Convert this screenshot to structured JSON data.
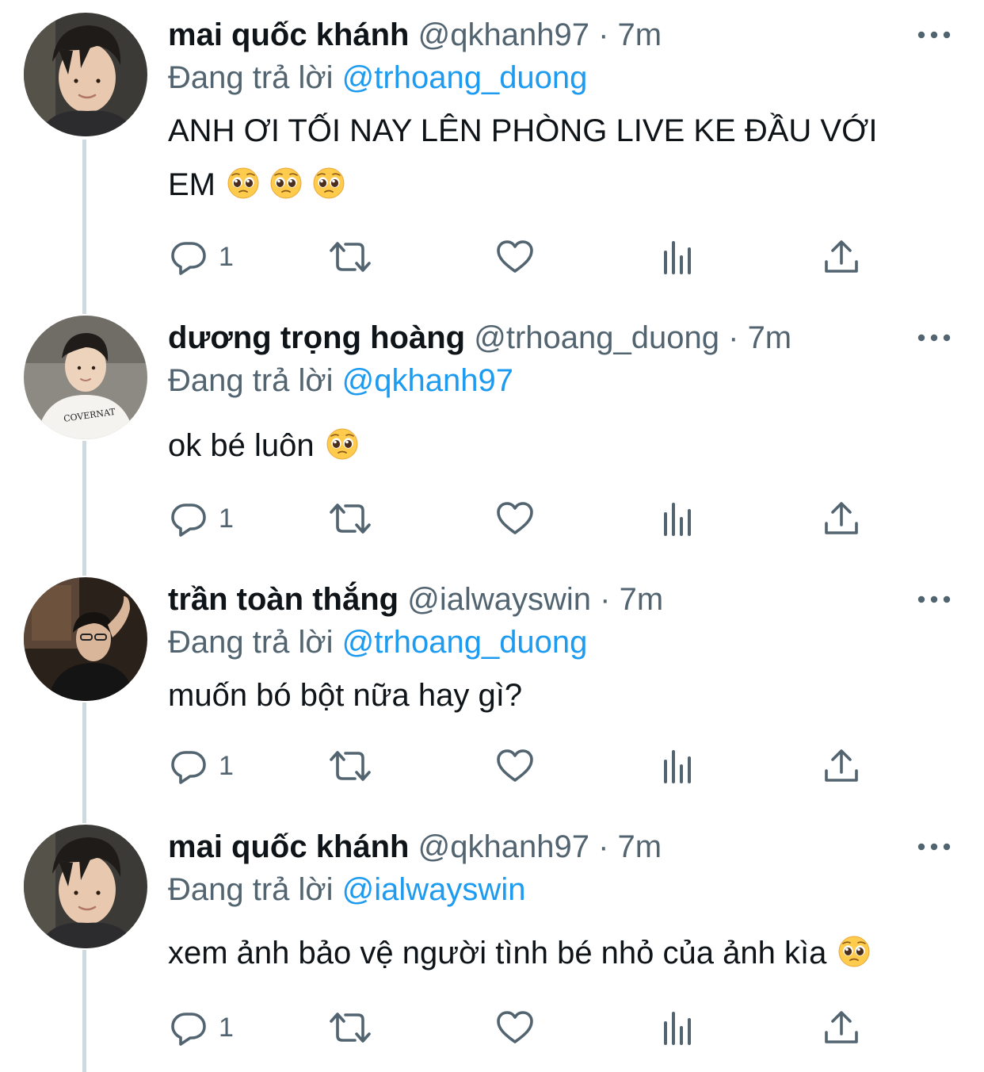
{
  "reply_prefix": "Đang trả lời",
  "separator": "·",
  "tweets": [
    {
      "name": "mai quốc khánh",
      "handle": "@qkhanh97",
      "time": "7m",
      "reply_to": "@trhoang_duong",
      "text_line1": "ANH ƠI TỐI NAY LÊN PHÒNG LIVE KE ĐẦU VỚI",
      "text_line2": "EM",
      "text_emojis": [
        "pleading-face-emoji",
        "pleading-face-emoji",
        "pleading-face-emoji"
      ],
      "reply_count": "1"
    },
    {
      "name": "dương trọng hoàng",
      "handle": "@trhoang_duong",
      "time": "7m",
      "reply_to": "@qkhanh97",
      "text": "ok bé luôn",
      "text_emojis": [
        "pleading-face-emoji"
      ],
      "reply_count": "1"
    },
    {
      "name": "trần toàn thắng",
      "handle": "@ialwayswin",
      "time": "7m",
      "reply_to": "@trhoang_duong",
      "text": "muốn bó bột nữa hay gì?",
      "text_emojis": [],
      "reply_count": "1"
    },
    {
      "name": "mai quốc khánh",
      "handle": "@qkhanh97",
      "time": "7m",
      "reply_to": "@ialwayswin",
      "text": "xem ảnh bảo vệ người tình bé nhỏ của ảnh kìa",
      "text_emojis": [
        "pleading-face-emoji"
      ],
      "reply_count": "1"
    }
  ],
  "icons": {
    "more": "more-horizontal-icon",
    "reply": "reply-bubble-icon",
    "retweet": "retweet-icon",
    "like": "heart-icon",
    "views": "analytics-bars-icon",
    "share": "share-upload-icon"
  },
  "colors": {
    "text": "#0f1419",
    "secondary": "#536471",
    "mention": "#1d9bf0",
    "thread_line": "#cfd9de",
    "background": "#ffffff"
  }
}
